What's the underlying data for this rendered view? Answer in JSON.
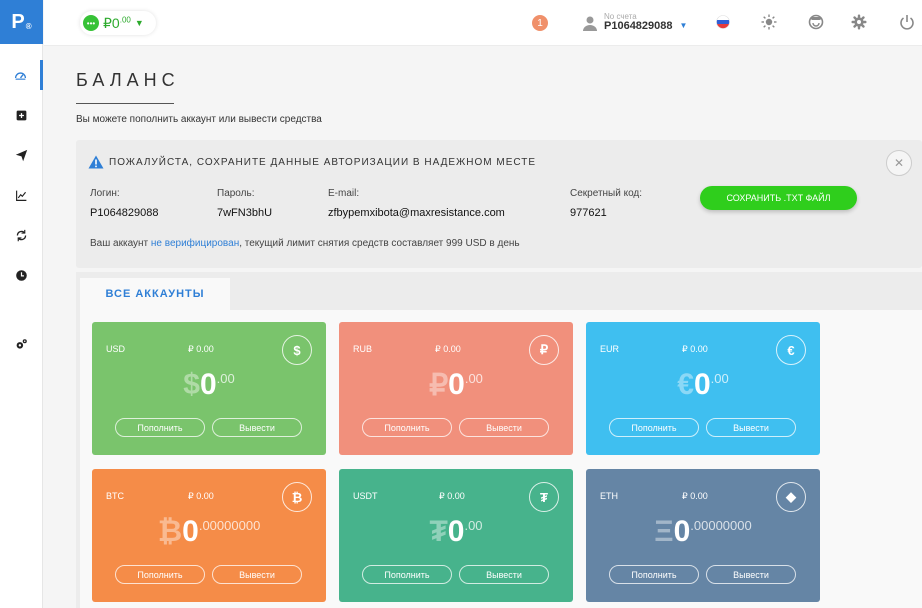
{
  "logo": {
    "letter": "P",
    "mark": "®"
  },
  "sidebar": {
    "items": [
      {
        "name": "dashboard-icon"
      },
      {
        "name": "add-square-icon"
      },
      {
        "name": "send-icon"
      },
      {
        "name": "chart-icon"
      },
      {
        "name": "exchange-icon"
      },
      {
        "name": "history-icon"
      },
      {
        "name": "settings-gear-icon"
      }
    ]
  },
  "topbar": {
    "wallet": {
      "icon_text": "•••",
      "currency": "₽",
      "amount": "0",
      "decimals": ".00"
    },
    "notifications": "1",
    "account": {
      "label": "No счета",
      "id": "P1064829088"
    }
  },
  "page": {
    "title": "БАЛАНС",
    "subtitle": "Вы можете пополнить аккаунт или вывести средства"
  },
  "alert": {
    "title": "ПОЖАЛУЙСТА, СОХРАНИТЕ ДАННЫЕ АВТОРИЗАЦИИ В НАДЕЖНОМ МЕСТЕ",
    "close": "✕",
    "login_label": "Логин:",
    "login_value": "P1064829088",
    "password_label": "Пароль:",
    "password_value": "7wFN3bhU",
    "email_label": "E-mail:",
    "email_value": "zfbypemxibota@maxresistance.com",
    "secret_label": "Секретный код:",
    "secret_value": "977621",
    "save_button": "СОХРАНИТЬ .TXT ФАЙЛ",
    "limit_prefix": "Ваш аккаунт ",
    "limit_link": "не верифицирован",
    "limit_suffix": ", текущий лимит снятия средств составляет 999 USD в день"
  },
  "tabs": {
    "all_accounts": "ВСЕ АККАУНТЫ"
  },
  "cards": [
    {
      "code": "USD",
      "rub": "₽ 0.00",
      "icon": "$",
      "symbol": "$",
      "int": "0",
      "dec": ".00",
      "deposit": "Пополнить",
      "withdraw": "Вывести",
      "color": "#7ac46c"
    },
    {
      "code": "RUB",
      "rub": "₽ 0.00",
      "icon": "₽",
      "symbol": "₽",
      "int": "0",
      "dec": ".00",
      "deposit": "Пополнить",
      "withdraw": "Вывести",
      "color": "#f1907c"
    },
    {
      "code": "EUR",
      "rub": "₽ 0.00",
      "icon": "€",
      "symbol": "€",
      "int": "0",
      "dec": ".00",
      "deposit": "Пополнить",
      "withdraw": "Вывести",
      "color": "#3fbff0"
    },
    {
      "code": "BTC",
      "rub": "₽ 0.00",
      "icon": "₿",
      "symbol": "₿",
      "int": "0",
      "dec": ".00000000",
      "deposit": "Пополнить",
      "withdraw": "Вывести",
      "color": "#f58c48"
    },
    {
      "code": "USDT",
      "rub": "₽ 0.00",
      "icon": "₮",
      "symbol": "₮",
      "int": "0",
      "dec": ".00",
      "deposit": "Пополнить",
      "withdraw": "Вывести",
      "color": "#47b38c"
    },
    {
      "code": "ETH",
      "rub": "₽ 0.00",
      "icon": "◆",
      "symbol": "Ξ",
      "int": "0",
      "dec": ".00000000",
      "deposit": "Пополнить",
      "withdraw": "Вывести",
      "color": "#6585a5"
    }
  ]
}
